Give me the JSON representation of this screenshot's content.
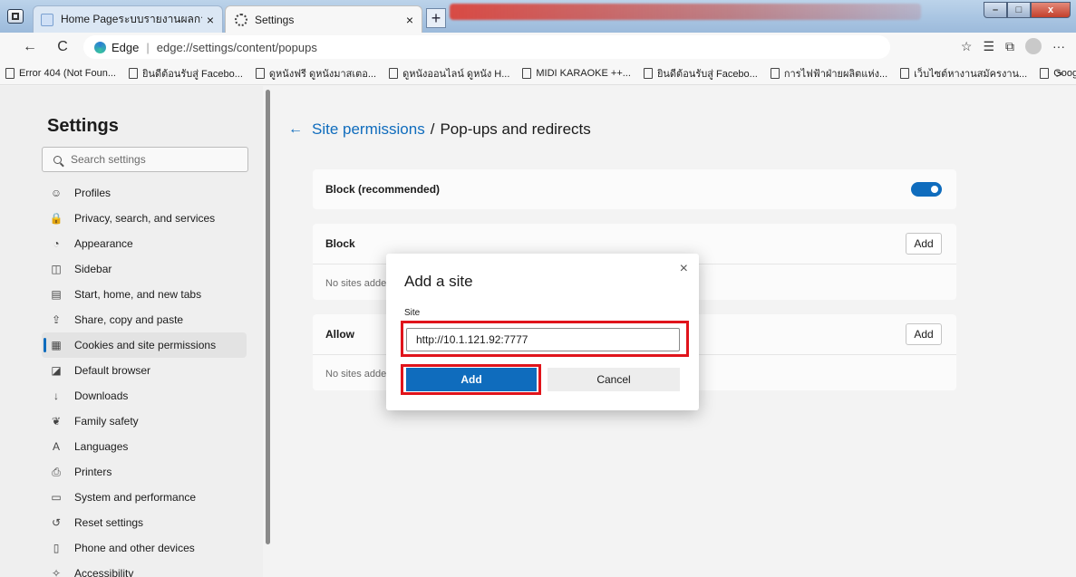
{
  "browser": {
    "tabs": [
      {
        "title": "Home Pageระบบรายงานผลการปฏิบั",
        "close": "×"
      },
      {
        "title": "Settings",
        "close": "×"
      }
    ],
    "new_tab": "+",
    "window_buttons": {
      "minimize": "–",
      "maximize": "□",
      "close": "x"
    }
  },
  "address_bar": {
    "back": "←",
    "refresh": "C",
    "brand": "Edge",
    "url": "edge://settings/content/popups",
    "icons": [
      "favorite-star-icon",
      "favorites-list-icon",
      "collections-icon",
      "profile-avatar-icon",
      "more-icon"
    ],
    "more": "···"
  },
  "favorites": [
    "Error 404 (Not Foun...",
    "ยินดีต้อนรับสู่ Facebo...",
    "ดูหนังฟรี ดูหนังมาสเตอ...",
    "ดูหนังออนไลน์ ดูหนัง H...",
    "MIDI KARAOKE ++...",
    "ยินดีต้อนรับสู่ Facebo...",
    "การไฟฟ้าฝ่ายผลิตแห่ง...",
    "เว็บไซต์หางานสมัครงาน...",
    "Google"
  ],
  "favorites_more": ">",
  "settings": {
    "title": "Settings",
    "search_placeholder": "Search settings",
    "nav": [
      {
        "label": "Profiles",
        "icon": "profile-icon",
        "glyph": "☺"
      },
      {
        "label": "Privacy, search, and services",
        "icon": "lock-icon",
        "glyph": "🔒"
      },
      {
        "label": "Appearance",
        "icon": "appearance-icon",
        "glyph": "◔"
      },
      {
        "label": "Sidebar",
        "icon": "sidebar-icon",
        "glyph": "◫"
      },
      {
        "label": "Start, home, and new tabs",
        "icon": "home-tabs-icon",
        "glyph": "▤"
      },
      {
        "label": "Share, copy and paste",
        "icon": "share-icon",
        "glyph": "⇪"
      },
      {
        "label": "Cookies and site permissions",
        "icon": "cookies-icon",
        "glyph": "▦"
      },
      {
        "label": "Default browser",
        "icon": "default-browser-icon",
        "glyph": "◪"
      },
      {
        "label": "Downloads",
        "icon": "download-icon",
        "glyph": "↓"
      },
      {
        "label": "Family safety",
        "icon": "family-icon",
        "glyph": "❦"
      },
      {
        "label": "Languages",
        "icon": "languages-icon",
        "glyph": "A"
      },
      {
        "label": "Printers",
        "icon": "printer-icon",
        "glyph": "⎙"
      },
      {
        "label": "System and performance",
        "icon": "system-icon",
        "glyph": "▭"
      },
      {
        "label": "Reset settings",
        "icon": "reset-icon",
        "glyph": "↺"
      },
      {
        "label": "Phone and other devices",
        "icon": "phone-icon",
        "glyph": "▯"
      },
      {
        "label": "Accessibility",
        "icon": "accessibility-icon",
        "glyph": "✧"
      }
    ],
    "active_index": 6
  },
  "page": {
    "breadcrumb_link": "Site permissions",
    "breadcrumb_sep": "/",
    "breadcrumb_current": "Pop-ups and redirects",
    "block_recommended": "Block (recommended)",
    "toggle_on": true,
    "block_section": {
      "title": "Block",
      "add": "Add",
      "empty": "No sites added"
    },
    "allow_section": {
      "title": "Allow",
      "add": "Add",
      "empty": "No sites added"
    }
  },
  "dialog": {
    "title": "Add a site",
    "close": "×",
    "field_label": "Site",
    "field_value": "http://10.1.121.92:7777",
    "add_label": "Add",
    "cancel_label": "Cancel"
  },
  "colors": {
    "accent": "#0f6cbd",
    "highlight_box": "#e0141b"
  }
}
